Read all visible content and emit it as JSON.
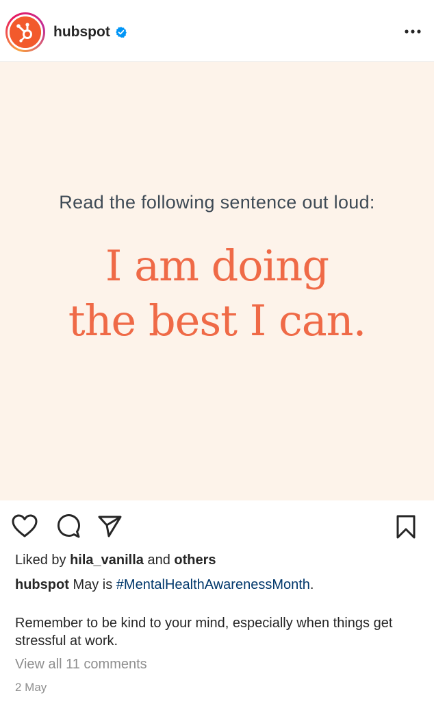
{
  "header": {
    "username": "hubspot",
    "verified_icon": "verified-badge-icon",
    "more_icon": "more-options-icon"
  },
  "post": {
    "prompt": "Read the following sentence out loud:",
    "headline_line1": "I am doing",
    "headline_line2": "the best I can.",
    "background_color": "#fdf3ea",
    "headline_color": "#ef6a47"
  },
  "actions": {
    "like_icon": "heart-icon",
    "comment_icon": "comment-icon",
    "share_icon": "send-icon",
    "save_icon": "bookmark-icon"
  },
  "likes": {
    "prefix": "Liked by",
    "user": "hila_vanilla",
    "middle": "and",
    "others": "others"
  },
  "caption": {
    "username": "hubspot",
    "text_before": "May is",
    "hashtag": "#MentalHealthAwarenessMonth",
    "text_after": ".",
    "body": "Remember to be kind to your mind, especially when things get stressful at work."
  },
  "comments": {
    "label": "View all 11 comments"
  },
  "timestamp": "2 May"
}
